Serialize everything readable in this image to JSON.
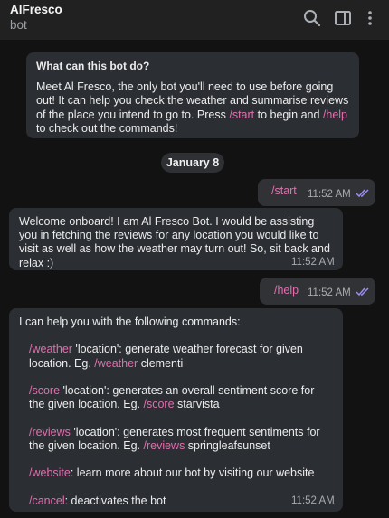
{
  "header": {
    "title": "AlFresco",
    "subtitle": "bot"
  },
  "chat": {
    "intro": {
      "title": "What can this bot do?",
      "text_before_start": "Meet Al Fresco, the only bot you'll need to use before going out! It can help you check the weather and summarise reviews of the place you intend to go to. Press ",
      "start_cmd": "/start",
      "text_between": " to begin and ",
      "help_cmd": "/help",
      "text_after_help": " to check out the commands!"
    },
    "date_separator": "January 8",
    "messages": {
      "user_start": {
        "text": "/start",
        "time": "11:52 AM"
      },
      "welcome": {
        "text": "Welcome onboard! I am Al Fresco Bot. I would be assisting you in fetching the reviews for any location you would like to visit as well as how the weather may turn out! So, sit back and relax :)",
        "time": "11:52 AM"
      },
      "user_help": {
        "text": "/help",
        "time": "11:52 AM"
      },
      "commands": {
        "intro": "I can help you with the following commands:",
        "weather_cmd": "/weather",
        "weather_desc": " 'location': generate weather forecast for given location. Eg. ",
        "weather_eg_cmd": "/weather",
        "weather_eg_arg": " clementi",
        "score_cmd": "/score",
        "score_desc": " 'location': generates an overall sentiment score for the given location. Eg. ",
        "score_eg_cmd": "/score",
        "score_eg_arg": " starvista",
        "reviews_cmd": "/reviews",
        "reviews_desc": " 'location': generates most frequent sentiments for the given location. Eg. ",
        "reviews_eg_cmd": "/reviews",
        "reviews_eg_arg": " springleafsunset",
        "website_cmd": "/website",
        "website_desc": ": learn more about our bot by visiting our website",
        "cancel_cmd": "/cancel",
        "cancel_desc": ": deactivates the bot",
        "time": "11:52 AM"
      }
    }
  },
  "icons": {
    "search": "search-icon",
    "sidebar": "sidebar-toggle-icon",
    "menu": "more-vertical-icon",
    "read": "double-check-icon"
  },
  "colors": {
    "accent_command": "#e06fae",
    "read_ticks": "#9b8cf0",
    "bubble": "#2b2e33",
    "header": "#212121"
  }
}
